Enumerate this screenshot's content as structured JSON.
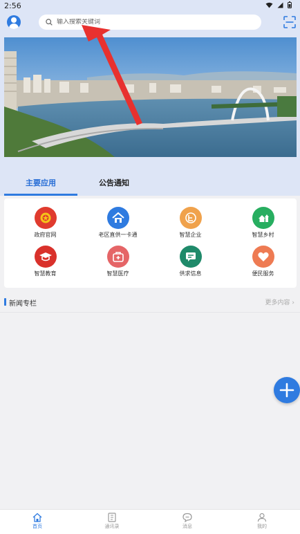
{
  "status_bar": {
    "time": "2:56"
  },
  "header": {
    "search_placeholder": "输入搜索关键词"
  },
  "tabs": [
    {
      "label": "主要应用",
      "active": true
    },
    {
      "label": "公告通知",
      "active": false
    }
  ],
  "apps": [
    {
      "label": "政府官网",
      "icon": "national-emblem-icon",
      "color": "#e03b2e"
    },
    {
      "label": "老区直供一卡通",
      "icon": "house-icon",
      "color": "#2f7be0"
    },
    {
      "label": "智慧企业",
      "icon": "enterprise-icon",
      "color": "#f0a24c"
    },
    {
      "label": "智慧乡村",
      "icon": "village-icon",
      "color": "#27ae60"
    },
    {
      "label": "智慧教育",
      "icon": "graduation-cap-icon",
      "color": "#d9312b"
    },
    {
      "label": "智慧医疗",
      "icon": "medical-kit-icon",
      "color": "#e56567"
    },
    {
      "label": "供求信息",
      "icon": "message-board-icon",
      "color": "#1f8a6a"
    },
    {
      "label": "便民服务",
      "icon": "heart-icon",
      "color": "#ee7b53"
    }
  ],
  "news": {
    "title": "新闻专栏",
    "more": "更多内容"
  },
  "bottom_nav": [
    {
      "label": "首页",
      "icon": "home-icon",
      "active": true
    },
    {
      "label": "通讯录",
      "icon": "contacts-icon",
      "active": false
    },
    {
      "label": "消息",
      "icon": "chat-icon",
      "active": false
    },
    {
      "label": "我的",
      "icon": "user-icon",
      "active": false
    }
  ],
  "colors": {
    "accent": "#2f7be0",
    "header_bg": "#dde5f6",
    "arrow": "#e8312f"
  }
}
